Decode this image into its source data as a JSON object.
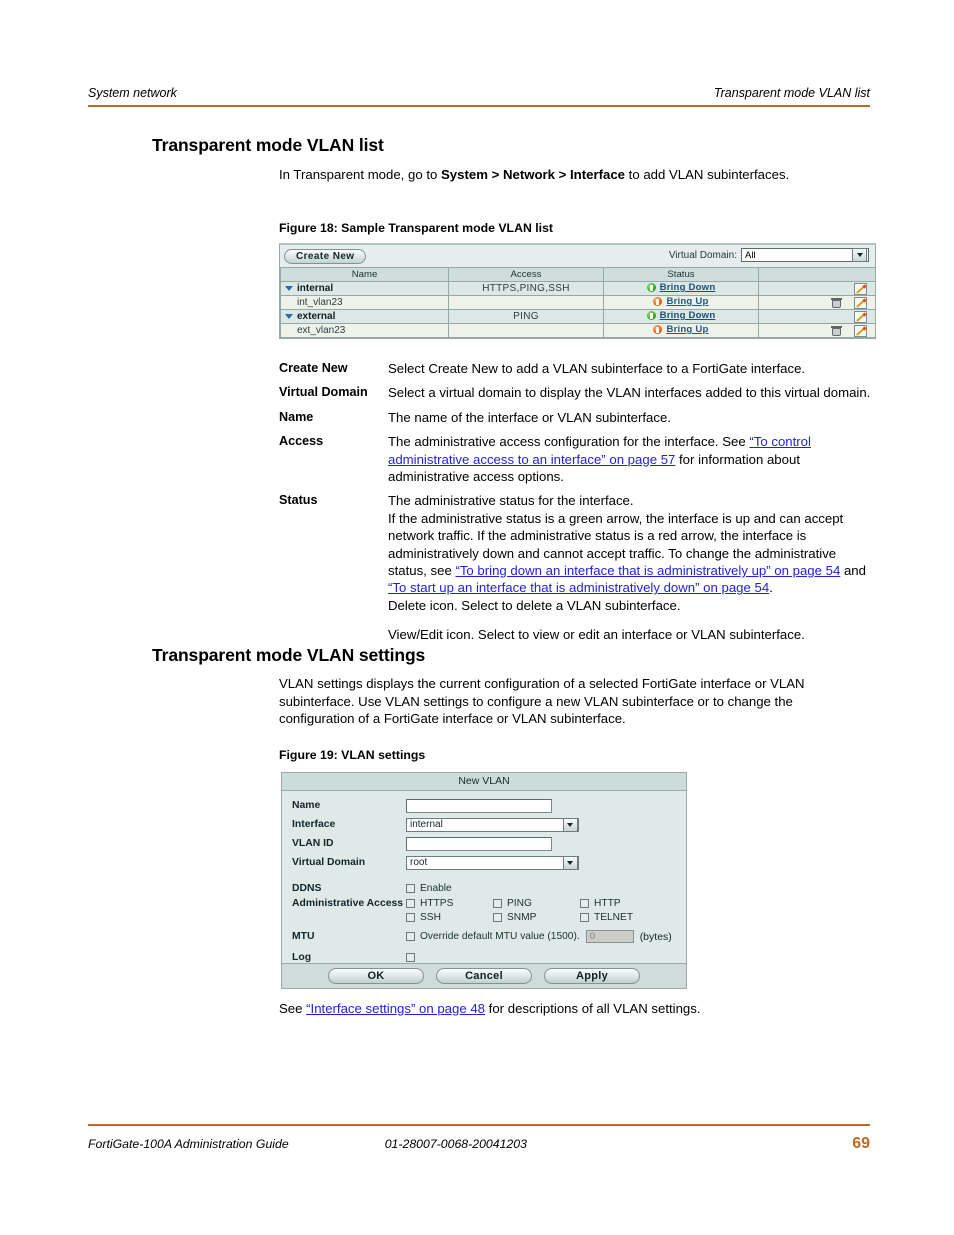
{
  "header": {
    "left": "System network",
    "right": "Transparent mode VLAN list"
  },
  "sections": {
    "vlan_list": {
      "heading": "Transparent mode VLAN list",
      "intro_pre": "In Transparent mode, go to ",
      "intro_path": "System > Network > Interface",
      "intro_post": " to add VLAN subinterfaces.",
      "figure_caption": "Figure 18: Sample Transparent mode VLAN list"
    },
    "vlan_settings": {
      "heading": "Transparent mode VLAN settings",
      "intro": "VLAN settings displays the current configuration of a selected FortiGate interface or VLAN subinterface. Use VLAN settings to configure a new VLAN subinterface or to change the configuration of a FortiGate interface or VLAN subinterface.",
      "figure_caption": "Figure 19: VLAN settings",
      "see_pre": "See ",
      "see_link": "“Interface settings” on page 48",
      "see_post": " for descriptions of all VLAN settings."
    }
  },
  "figure18": {
    "create_new_label": "Create New",
    "virtual_domain_label": "Virtual Domain:",
    "virtual_domain_value": "All",
    "columns": [
      "Name",
      "Access",
      "Status",
      ""
    ],
    "rows": [
      {
        "level": "parent",
        "name": "internal",
        "access": "HTTPS,PING,SSH",
        "status_label": "Bring Down",
        "status_state": "up",
        "has_delete": false,
        "has_edit": true
      },
      {
        "level": "child",
        "name": "int_vlan23",
        "access": "",
        "status_label": "Bring Up",
        "status_state": "down",
        "has_delete": true,
        "has_edit": true
      },
      {
        "level": "parent",
        "name": "external",
        "access": "PING",
        "status_label": "Bring Down",
        "status_state": "up",
        "has_delete": false,
        "has_edit": true
      },
      {
        "level": "child",
        "name": "ext_vlan23",
        "access": "",
        "status_label": "Bring Up",
        "status_state": "down",
        "has_delete": true,
        "has_edit": true
      }
    ]
  },
  "definitions": [
    {
      "term": "Create New",
      "parts": [
        {
          "t": "Select Create New to add a VLAN subinterface to a FortiGate interface."
        }
      ]
    },
    {
      "term": "Virtual Domain",
      "parts": [
        {
          "t": "Select a virtual domain to display the VLAN interfaces added to this virtual domain."
        }
      ]
    },
    {
      "term": "Name",
      "parts": [
        {
          "t": "The name of the interface or VLAN subinterface."
        }
      ]
    },
    {
      "term": "Access",
      "parts": [
        {
          "t": "The administrative access configuration for the interface. See "
        },
        {
          "t": "“To control administrative access to an interface” on page 57",
          "link": true
        },
        {
          "t": " for information about administrative access options."
        }
      ]
    },
    {
      "term": "Status",
      "parts": [
        {
          "t": "The administrative status for the interface."
        },
        {
          "br": true
        },
        {
          "t": "If the administrative status is a green arrow, the interface is up and can accept network traffic. If the administrative status is a red arrow, the interface is administratively down and cannot accept traffic. To change the administrative status, see "
        },
        {
          "t": "“To bring down an interface that is administratively up” on page 54",
          "link": true
        },
        {
          "t": " and "
        },
        {
          "t": "“To start up an interface that is administratively down” on page 54",
          "link": true
        },
        {
          "t": "."
        }
      ]
    },
    {
      "term": "",
      "parts": [
        {
          "t": "Delete icon. Select to delete a VLAN subinterface."
        }
      ]
    },
    {
      "term": "",
      "parts": [
        {
          "t": "View/Edit icon. Select to view or edit an interface or VLAN subinterface."
        }
      ]
    }
  ],
  "figure19": {
    "title": "New VLAN",
    "fields": {
      "name_label": "Name",
      "name_value": "",
      "interface_label": "Interface",
      "interface_value": "internal",
      "vlan_id_label": "VLAN ID",
      "vlan_id_value": "",
      "virtual_domain_label": "Virtual Domain",
      "virtual_domain_value": "root",
      "ddns_label": "DDNS",
      "ddns_enable_label": "Enable",
      "admin_access_label": "Administrative Access",
      "admin_access_options": [
        "HTTPS",
        "PING",
        "HTTP",
        "SSH",
        "SNMP",
        "TELNET"
      ],
      "mtu_label": "MTU",
      "mtu_override_label": "Override default MTU value (1500).",
      "mtu_value": "0",
      "mtu_units": "(bytes)",
      "log_label": "Log"
    },
    "buttons": {
      "ok": "OK",
      "cancel": "Cancel",
      "apply": "Apply"
    }
  },
  "footer": {
    "guide": "FortiGate-100A Administration Guide",
    "doc_id": "01-28007-0068-20041203",
    "page_number": "69"
  },
  "colors": {
    "rule": "#c1691c",
    "link": "#2222dd",
    "page_number": "#c1691c",
    "status_up": "#19a31b",
    "status_down": "#e2540d"
  }
}
